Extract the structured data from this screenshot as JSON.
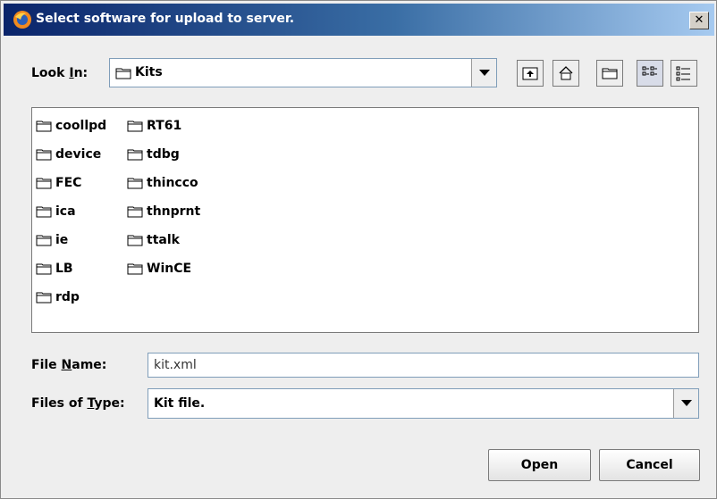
{
  "window": {
    "title": "Select software for upload to server.",
    "close_glyph": "✕",
    "icon": "app-globe-icon"
  },
  "look_in": {
    "label_pre": "Look ",
    "label_mnemonic": "I",
    "label_post": "n:",
    "value": "Kits",
    "icon": "folder-icon"
  },
  "toolbar": {
    "buttons": [
      "up-one-level-icon",
      "home-icon",
      "new-folder-icon",
      "list-view-icon",
      "details-view-icon"
    ]
  },
  "files": [
    {
      "name": "coollpd"
    },
    {
      "name": "device"
    },
    {
      "name": "FEC"
    },
    {
      "name": "ica"
    },
    {
      "name": "ie"
    },
    {
      "name": "LB"
    },
    {
      "name": "rdp"
    },
    {
      "name": "RT61"
    },
    {
      "name": "tdbg"
    },
    {
      "name": "thincco"
    },
    {
      "name": "thnprnt"
    },
    {
      "name": "ttalk"
    },
    {
      "name": "WinCE"
    }
  ],
  "file_name": {
    "label_pre": "File ",
    "label_mnemonic": "N",
    "label_post": "ame:",
    "value": "kit.xml"
  },
  "file_type": {
    "label_pre": "Files of ",
    "label_mnemonic": "T",
    "label_post": "ype:",
    "value": "Kit file."
  },
  "buttons": {
    "open": "Open",
    "cancel": "Cancel"
  }
}
